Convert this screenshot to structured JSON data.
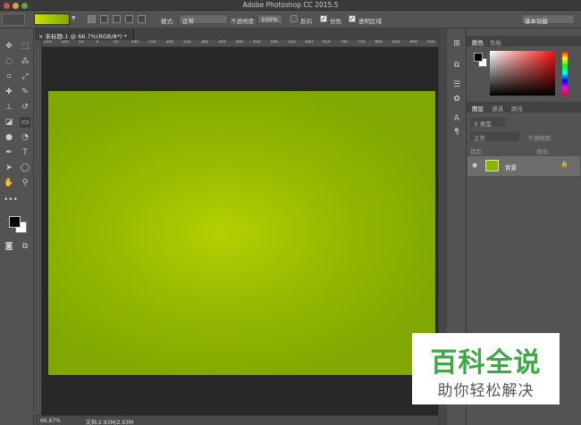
{
  "window": {
    "title": "Adobe Photoshop CC 2015.5"
  },
  "options_bar": {
    "gradient_colors": [
      "#c7e000",
      "#7fa800"
    ],
    "mode_label": "模式:",
    "mode_value": "正常",
    "opacity_label": "不透明度:",
    "opacity_value": "100%",
    "reverse_label": "反向",
    "reverse_checked": false,
    "dither_label": "仿色",
    "dither_checked": true,
    "transparency_label": "透明区域",
    "transparency_checked": true,
    "workspace_value": "基本功能"
  },
  "document": {
    "tab_label": "未标题-1 @ 66.7%(RGB/8*) *",
    "ruler_ticks": [
      "150",
      "100",
      "50",
      "0",
      "50",
      "100",
      "150",
      "200",
      "250",
      "300",
      "350",
      "400",
      "450",
      "500",
      "550",
      "600",
      "650",
      "700",
      "750",
      "800",
      "850",
      "900",
      "950"
    ],
    "zoom": "66.67%",
    "doc_info": "文档:2.93M/2.93M",
    "canvas_colors": [
      "#b4d000",
      "#80a800"
    ]
  },
  "tools": [
    "move-icon",
    "marquee-icon",
    "lasso-icon",
    "magic-wand-icon",
    "crop-icon",
    "eyedropper-icon",
    "healing-icon",
    "brush-icon",
    "stamp-icon",
    "history-brush-icon",
    "eraser-icon",
    "gradient-icon",
    "blur-icon",
    "dodge-icon",
    "pen-icon",
    "type-icon",
    "path-select-icon",
    "shape-icon",
    "hand-icon",
    "zoom-icon",
    "more-icon"
  ],
  "colors": {
    "foreground": "#000000",
    "background": "#ffffff"
  },
  "panels": {
    "color_tabs": [
      "颜色",
      "色板"
    ],
    "layer_tabs": [
      "图层",
      "通道",
      "路径"
    ],
    "filter_kind": "类型",
    "blend_mode": "正常",
    "opacity_label": "不透明度:",
    "lock_label": "锁定:",
    "fill_label": "填充:",
    "layers": [
      {
        "name": "背景",
        "visible": true,
        "locked": true
      }
    ]
  },
  "watermark": {
    "title": "百科全说",
    "subtitle": "助你轻松解决"
  }
}
